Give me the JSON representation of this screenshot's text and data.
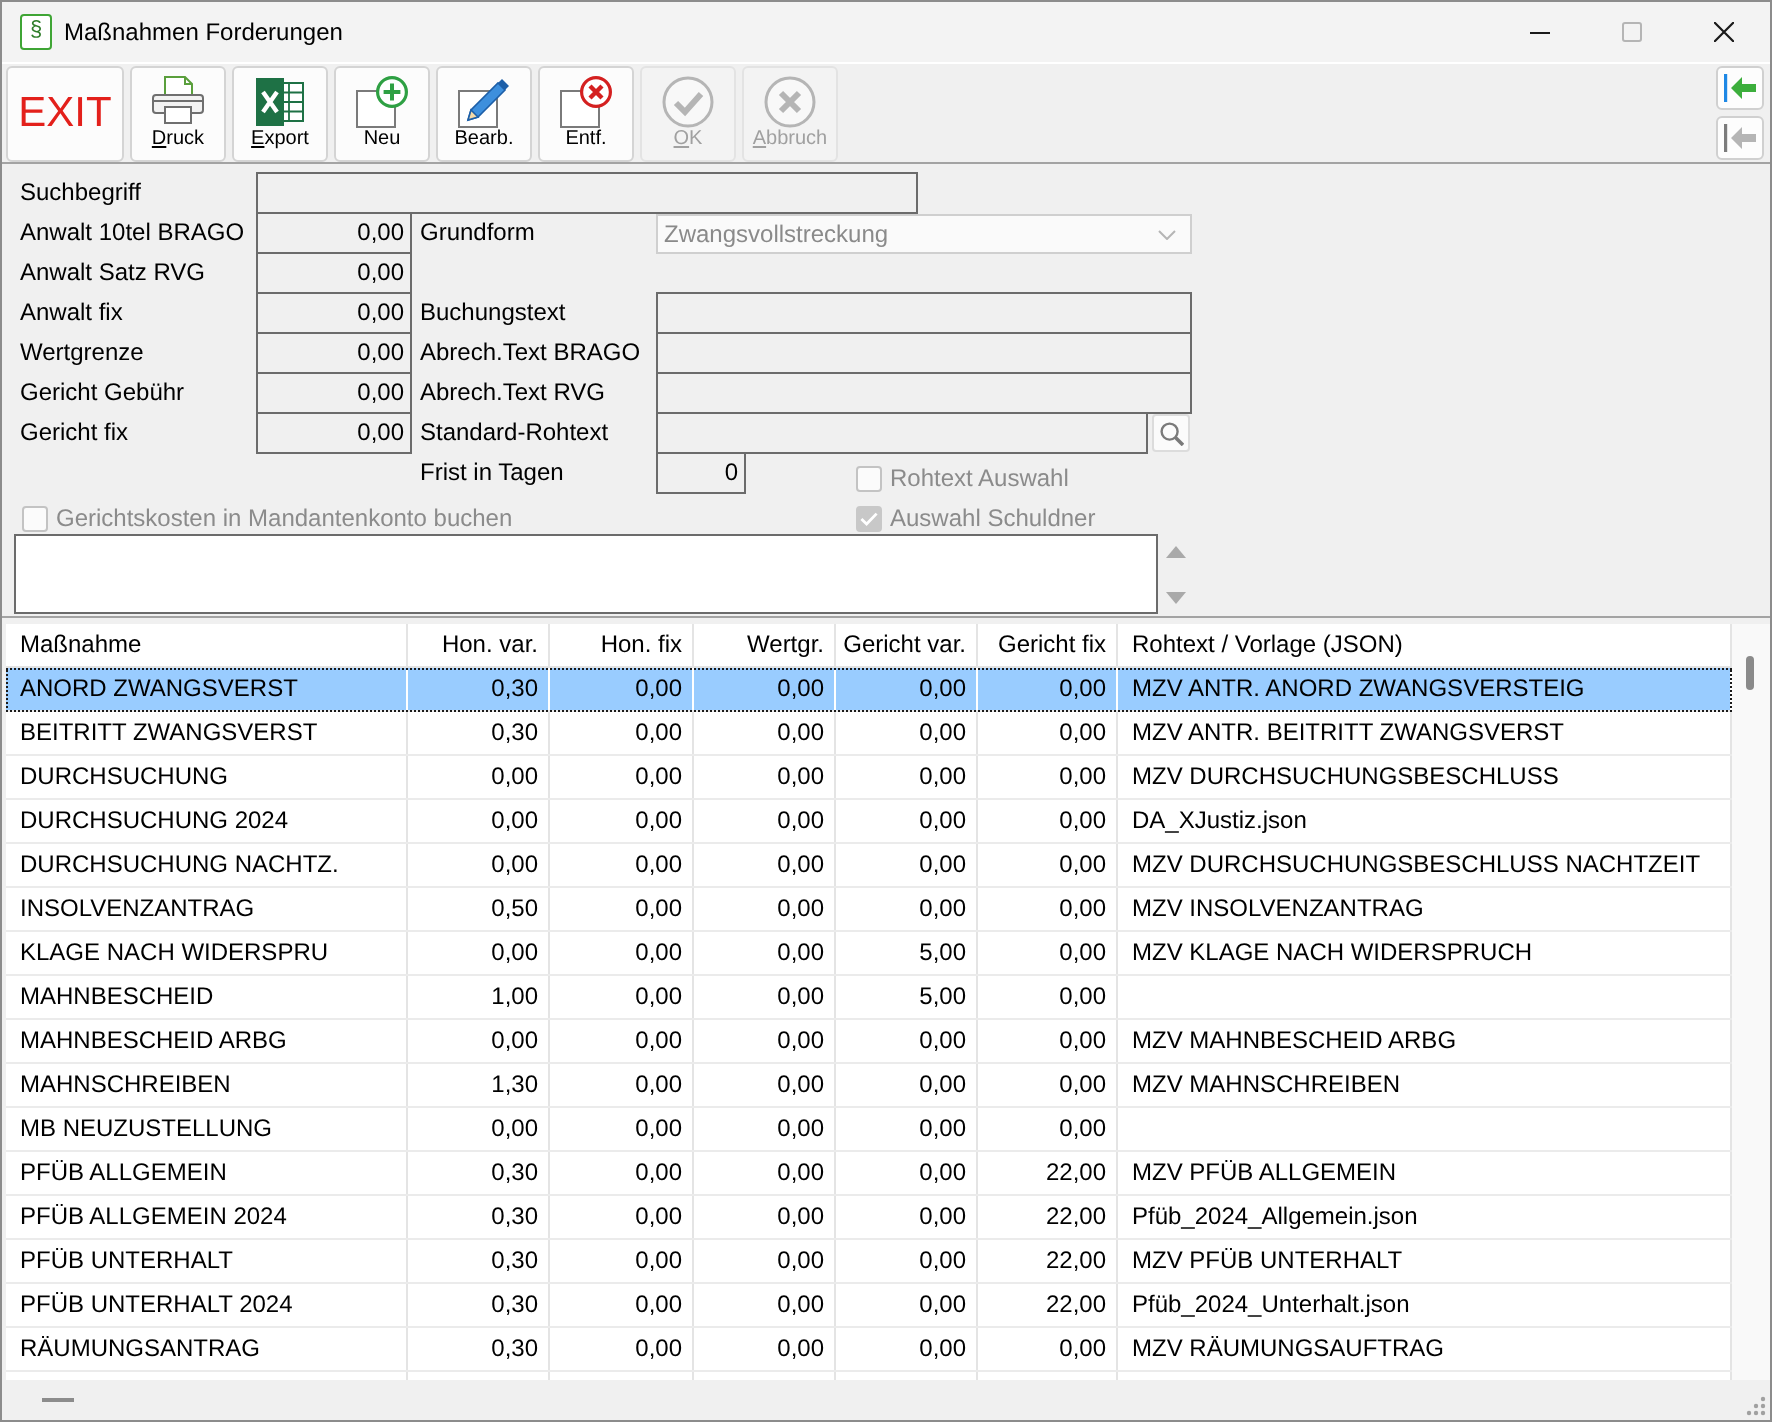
{
  "window": {
    "icon": "§",
    "title": "Maßnahmen Forderungen",
    "buttons": [
      {
        "kind": "minimize",
        "disabled": false
      },
      {
        "kind": "maximize",
        "disabled": true
      },
      {
        "kind": "close",
        "disabled": false
      }
    ]
  },
  "toolbar": [
    {
      "kind": "exit",
      "label": "EXIT",
      "mnemonic": false,
      "disabled": false
    },
    {
      "kind": "print",
      "label": "Druck",
      "mnemonic": true,
      "disabled": false
    },
    {
      "kind": "export",
      "label": "Export",
      "mnemonic": true,
      "disabled": false
    },
    {
      "kind": "new",
      "label": "Neu",
      "mnemonic": false,
      "disabled": false
    },
    {
      "kind": "edit",
      "label": "Bearb.",
      "mnemonic": false,
      "disabled": false
    },
    {
      "kind": "delete",
      "label": "Entf.",
      "mnemonic": false,
      "disabled": false
    },
    {
      "kind": "ok",
      "label": "OK",
      "mnemonic": true,
      "disabled": true
    },
    {
      "kind": "cancel",
      "label": "Abbruch",
      "mnemonic": true,
      "disabled": true
    }
  ],
  "side_buttons": [
    {
      "disabled": false
    },
    {
      "disabled": true
    }
  ],
  "form": {
    "search": {
      "label": "Suchbegriff"
    },
    "amounts": [
      {
        "label": "Anwalt 10tel BRAGO",
        "value": "0,00"
      },
      {
        "label": "Anwalt Satz RVG",
        "value": "0,00"
      },
      {
        "label": "Anwalt fix",
        "value": "0,00"
      },
      {
        "label": "Wertgrenze",
        "value": "0,00"
      },
      {
        "label": "Gericht Gebühr",
        "value": "0,00"
      },
      {
        "label": "Gericht fix",
        "value": "0,00"
      }
    ],
    "grundform": {
      "label": "Grundform",
      "value": "Zwangsvollstreckung",
      "disabled": true
    },
    "texts": [
      {
        "kind": "text",
        "label": "Buchungstext"
      },
      {
        "kind": "text",
        "label": "Abrech.Text BRAGO"
      },
      {
        "kind": "text",
        "label": "Abrech.Text RVG"
      },
      {
        "kind": "lookup",
        "label": "Standard-Rohtext"
      }
    ],
    "frist": {
      "label": "Frist in Tagen",
      "value": "0"
    },
    "rohtext_auswahl": {
      "label": "Rohtext Auswahl",
      "checked": false,
      "disabled": true
    },
    "gerichtskosten": {
      "label": "Gerichtskosten in Mandantenkonto buchen",
      "checked": false,
      "disabled": true
    },
    "auswahl_schuldner": {
      "label": "Auswahl Schuldner",
      "checked": true,
      "disabled": true
    }
  },
  "table": {
    "columns": [
      {
        "label": "Maßnahme",
        "kind": "text"
      },
      {
        "label": "Hon. var.",
        "kind": "number"
      },
      {
        "label": "Hon. fix",
        "kind": "number"
      },
      {
        "label": "Wertgr.",
        "kind": "number"
      },
      {
        "label": "Gericht var.",
        "kind": "number"
      },
      {
        "label": "Gericht fix",
        "kind": "number"
      },
      {
        "label": "Rohtext / Vorlage (JSON)",
        "kind": "text"
      }
    ],
    "rows": [
      {
        "selected": true,
        "cells": [
          "ANORD ZWANGSVERST",
          "0,30",
          "0,00",
          "0,00",
          "0,00",
          "0,00",
          "MZV ANTR. ANORD ZWANGSVERSTEIG"
        ]
      },
      {
        "selected": false,
        "cells": [
          "BEITRITT ZWANGSVERST",
          "0,30",
          "0,00",
          "0,00",
          "0,00",
          "0,00",
          "MZV ANTR. BEITRITT ZWANGSVERST"
        ]
      },
      {
        "selected": false,
        "cells": [
          "DURCHSUCHUNG",
          "0,00",
          "0,00",
          "0,00",
          "0,00",
          "0,00",
          "MZV DURCHSUCHUNGSBESCHLUSS"
        ]
      },
      {
        "selected": false,
        "cells": [
          "DURCHSUCHUNG 2024",
          "0,00",
          "0,00",
          "0,00",
          "0,00",
          "0,00",
          "DA_XJustiz.json"
        ]
      },
      {
        "selected": false,
        "cells": [
          "DURCHSUCHUNG NACHTZ.",
          "0,00",
          "0,00",
          "0,00",
          "0,00",
          "0,00",
          "MZV DURCHSUCHUNGSBESCHLUSS NACHTZEIT"
        ]
      },
      {
        "selected": false,
        "cells": [
          "INSOLVENZANTRAG",
          "0,50",
          "0,00",
          "0,00",
          "0,00",
          "0,00",
          "MZV INSOLVENZANTRAG"
        ]
      },
      {
        "selected": false,
        "cells": [
          "KLAGE NACH WIDERSPRU",
          "0,00",
          "0,00",
          "0,00",
          "5,00",
          "0,00",
          "MZV KLAGE NACH WIDERSPRUCH"
        ]
      },
      {
        "selected": false,
        "cells": [
          "MAHNBESCHEID",
          "1,00",
          "0,00",
          "0,00",
          "5,00",
          "0,00"
        ]
      },
      {
        "selected": false,
        "cells": [
          "MAHNBESCHEID ARBG",
          "0,00",
          "0,00",
          "0,00",
          "0,00",
          "0,00",
          "MZV MAHNBESCHEID ARBG"
        ]
      },
      {
        "selected": false,
        "cells": [
          "MAHNSCHREIBEN",
          "1,30",
          "0,00",
          "0,00",
          "0,00",
          "0,00",
          "MZV MAHNSCHREIBEN"
        ]
      },
      {
        "selected": false,
        "cells": [
          "MB NEUZUSTELLUNG",
          "0,00",
          "0,00",
          "0,00",
          "0,00",
          "0,00"
        ]
      },
      {
        "selected": false,
        "cells": [
          "PFÜB ALLGEMEIN",
          "0,30",
          "0,00",
          "0,00",
          "0,00",
          "22,00",
          "MZV PFÜB ALLGEMEIN"
        ]
      },
      {
        "selected": false,
        "cells": [
          "PFÜB ALLGEMEIN 2024",
          "0,30",
          "0,00",
          "0,00",
          "0,00",
          "22,00",
          "Pfüb_2024_Allgemein.json"
        ]
      },
      {
        "selected": false,
        "cells": [
          "PFÜB UNTERHALT",
          "0,30",
          "0,00",
          "0,00",
          "0,00",
          "22,00",
          "MZV PFÜB UNTERHALT"
        ]
      },
      {
        "selected": false,
        "cells": [
          "PFÜB UNTERHALT 2024",
          "0,30",
          "0,00",
          "0,00",
          "0,00",
          "22,00",
          "Pfüb_2024_Unterhalt.json"
        ]
      },
      {
        "selected": false,
        "cells": [
          "RÄUMUNGSANTRAG",
          "0,30",
          "0,00",
          "0,00",
          "0,00",
          "0,00",
          "MZV RÄUMUNGSAUFTRAG"
        ]
      }
    ]
  }
}
